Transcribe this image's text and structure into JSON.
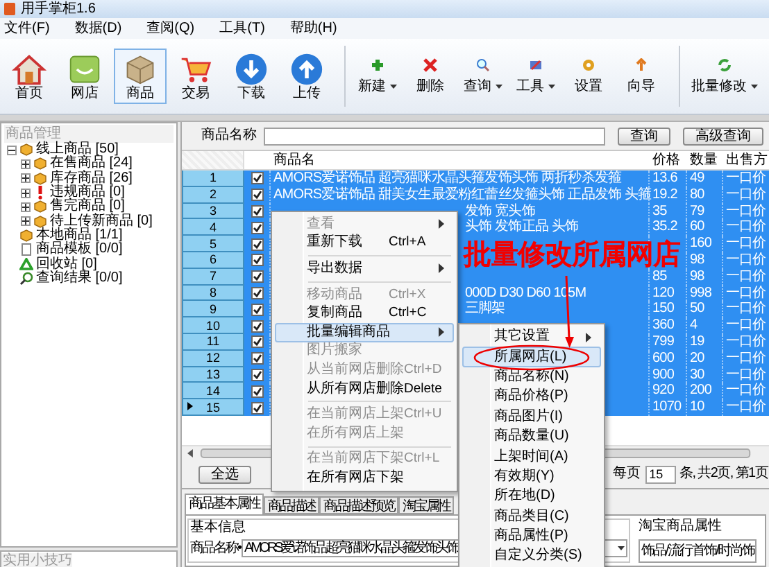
{
  "window": {
    "title": "用手掌柜1.6"
  },
  "menu": [
    "文件(F)",
    "数据(D)",
    "查阅(Q)",
    "工具(T)",
    "帮助(H)"
  ],
  "toolbar": {
    "large": [
      {
        "label": "首页",
        "selected": false
      },
      {
        "label": "网店",
        "selected": false
      },
      {
        "label": "商品",
        "selected": true
      },
      {
        "label": "交易",
        "selected": false
      },
      {
        "label": "下载",
        "selected": false
      },
      {
        "label": "上传",
        "selected": false
      }
    ],
    "small": [
      {
        "label": "新建",
        "dropdown": true
      },
      {
        "label": "删除",
        "dropdown": false
      },
      {
        "label": "查询",
        "dropdown": true
      },
      {
        "label": "工具",
        "dropdown": true
      },
      {
        "label": "设置",
        "dropdown": false
      },
      {
        "label": "向导",
        "dropdown": false
      }
    ],
    "batch": {
      "label": "批量修改",
      "dropdown": true
    }
  },
  "sidebar": {
    "title": "商品管理",
    "tips_title": "实用小技巧",
    "tree": [
      {
        "label": "线上商品",
        "count": "[50]",
        "kind": "package",
        "expanded": true,
        "children": [
          {
            "label": "在售商品",
            "count": "[24]",
            "kind": "package",
            "expanded": false
          },
          {
            "label": "库存商品",
            "count": "[26]",
            "kind": "package",
            "expanded": false
          },
          {
            "label": "违规商品",
            "count": "[0]",
            "kind": "warning",
            "expanded": false
          },
          {
            "label": "售完商品",
            "count": "[0]",
            "kind": "package",
            "expanded": false
          },
          {
            "label": "待上传新商品",
            "count": "[0]",
            "kind": "package",
            "expanded": false
          }
        ]
      },
      {
        "label": "本地商品",
        "count": "[1/1]",
        "kind": "package"
      },
      {
        "label": "商品模板",
        "count": "[0/0]",
        "kind": "template"
      },
      {
        "label": "回收站",
        "count": "[0]",
        "kind": "recycle"
      },
      {
        "label": "查询结果",
        "count": "[0/0]",
        "kind": "search"
      }
    ]
  },
  "search": {
    "label": "商品名称",
    "buttons": [
      "查询",
      "高级查询"
    ]
  },
  "table": {
    "columns": [
      "商品名",
      "价格",
      "数量",
      "出售方"
    ],
    "rows": [
      {
        "no": "1",
        "checked": true,
        "selected": true,
        "current": false,
        "kind": "full",
        "name": "AMORS爱诺饰品 超亮猫咪水晶头箍发饰头饰 两折秒杀发箍",
        "price": "13.6",
        "qty": "49",
        "method": "一口价"
      },
      {
        "no": "2",
        "checked": true,
        "selected": true,
        "current": false,
        "kind": "full",
        "name": "AMORS爱诺饰品 甜美女生最爱粉红蕾丝发箍头饰 正品发饰 头箍",
        "price": "19.2",
        "qty": "80",
        "method": "一口价"
      },
      {
        "no": "3",
        "checked": true,
        "selected": true,
        "current": false,
        "kind": "partial",
        "name": "发饰 宽头饰",
        "price": "35",
        "qty": "79",
        "method": "一口价"
      },
      {
        "no": "4",
        "checked": true,
        "selected": true,
        "current": false,
        "kind": "partial",
        "name": "头饰 发饰正品 头饰",
        "price": "35.2",
        "qty": "60",
        "method": "一口价"
      },
      {
        "no": "5",
        "checked": true,
        "selected": true,
        "current": false,
        "kind": "partial",
        "qty": "160",
        "method": "一口价"
      },
      {
        "no": "6",
        "checked": true,
        "selected": true,
        "current": false,
        "kind": "partial",
        "qty": "98",
        "method": "一口价"
      },
      {
        "no": "7",
        "checked": true,
        "selected": true,
        "current": false,
        "kind": "partial",
        "price": "85",
        "qty": "98",
        "method": "一口价"
      },
      {
        "no": "8",
        "checked": true,
        "selected": true,
        "current": false,
        "kind": "partial",
        "name": "000D D30 D60 105M",
        "price": "120",
        "qty": "998",
        "method": "一口价"
      },
      {
        "no": "9",
        "checked": true,
        "selected": true,
        "current": false,
        "kind": "partial",
        "name": "三脚架",
        "price": "150",
        "qty": "50",
        "method": "一口价"
      },
      {
        "no": "10",
        "checked": true,
        "selected": true,
        "current": false,
        "kind": "partial",
        "price": "360",
        "qty": "4",
        "method": "一口价"
      },
      {
        "no": "11",
        "checked": true,
        "selected": true,
        "current": false,
        "kind": "partial",
        "price": "799",
        "qty": "19",
        "method": "一口价"
      },
      {
        "no": "12",
        "checked": true,
        "selected": true,
        "current": false,
        "kind": "partial",
        "price": "600",
        "qty": "20",
        "method": "一口价"
      },
      {
        "no": "13",
        "checked": true,
        "selected": true,
        "current": false,
        "kind": "partial",
        "price": "900",
        "qty": "30",
        "method": "一口价"
      },
      {
        "no": "14",
        "checked": true,
        "selected": true,
        "current": false,
        "kind": "partial",
        "price": "920",
        "qty": "200",
        "method": "一口价"
      },
      {
        "no": "15",
        "checked": true,
        "selected": true,
        "current": true,
        "kind": "partial",
        "price": "1070",
        "qty": "10",
        "method": "一口价"
      }
    ]
  },
  "pager": {
    "select_all": "全选",
    "per_page_label": "每页",
    "per_page": "15",
    "summary": "条, 共2页, 第1页"
  },
  "detail": {
    "tabs": [
      {
        "label": "商品基本属性",
        "selected": true
      },
      {
        "label": "商品描述",
        "selected": false
      },
      {
        "label": "商品描述预览",
        "selected": false
      },
      {
        "label": "淘宝属性",
        "selected": false
      }
    ],
    "group": "基本信息",
    "name_label": "商品名称•",
    "name_value": "AMORS爱诺饰品 超亮猫咪水晶头箍发饰头饰",
    "taobao_title": "淘宝商品属性",
    "category": "饰品/流行首饰/时尚饰"
  },
  "context_menu": {
    "items": [
      {
        "kind": "item",
        "label": "查看",
        "disabled": true,
        "submenu": true,
        "selected": false
      },
      {
        "kind": "item",
        "label": "重新下载",
        "shortcut": "Ctrl+A",
        "disabled": false,
        "submenu": false,
        "selected": false
      },
      {
        "kind": "separator"
      },
      {
        "kind": "item",
        "label": "导出数据",
        "disabled": false,
        "submenu": true,
        "selected": false
      },
      {
        "kind": "separator"
      },
      {
        "kind": "item",
        "label": "移动商品",
        "shortcut": "Ctrl+X",
        "disabled": true,
        "submenu": false,
        "selected": false
      },
      {
        "kind": "item",
        "label": "复制商品",
        "shortcut": "Ctrl+C",
        "disabled": false,
        "submenu": false,
        "selected": false
      },
      {
        "kind": "item",
        "label": "批量编辑商品",
        "disabled": false,
        "submenu": true,
        "selected": true
      },
      {
        "kind": "item",
        "label": "图片搬家",
        "disabled": true,
        "submenu": false,
        "selected": false
      },
      {
        "kind": "item",
        "label": "从当前网店删除",
        "shortcut": "Ctrl+D",
        "disabled": true,
        "submenu": false,
        "selected": false
      },
      {
        "kind": "item",
        "label": "从所有网店删除",
        "shortcut": "Delete",
        "disabled": false,
        "submenu": false,
        "selected": false
      },
      {
        "kind": "separator"
      },
      {
        "kind": "item",
        "label": "在当前网店上架",
        "shortcut": "Ctrl+U",
        "disabled": true,
        "submenu": false,
        "selected": false
      },
      {
        "kind": "item",
        "label": "在所有网店上架",
        "disabled": true,
        "submenu": false,
        "selected": false
      },
      {
        "kind": "separator"
      },
      {
        "kind": "item",
        "label": "在当前网店下架",
        "shortcut": "Ctrl+L",
        "disabled": true,
        "submenu": false,
        "selected": false
      },
      {
        "kind": "item",
        "label": "在所有网店下架",
        "disabled": false,
        "submenu": false,
        "selected": false
      }
    ],
    "submenu": [
      {
        "label": "其它设置",
        "submenu": true,
        "selected": false
      },
      {
        "label": "所属网店(L)",
        "submenu": false,
        "selected": true
      },
      {
        "label": "商品名称(N)",
        "submenu": false,
        "selected": false
      },
      {
        "label": "商品价格(P)",
        "submenu": false,
        "selected": false
      },
      {
        "label": "商品图片(I)",
        "submenu": false,
        "selected": false
      },
      {
        "label": "商品数量(U)",
        "submenu": false,
        "selected": false
      },
      {
        "label": "上架时间(A)",
        "submenu": false,
        "selected": false
      },
      {
        "label": "有效期(Y)",
        "submenu": false,
        "selected": false
      },
      {
        "label": "所在地(D)",
        "submenu": false,
        "selected": false
      },
      {
        "label": "商品类目(C)",
        "submenu": false,
        "selected": false
      },
      {
        "label": "商品属性(P)",
        "submenu": false,
        "selected": false
      },
      {
        "label": "自定义分类(S)",
        "submenu": false,
        "selected": false
      }
    ]
  },
  "annotation": "批量修改所属网店"
}
